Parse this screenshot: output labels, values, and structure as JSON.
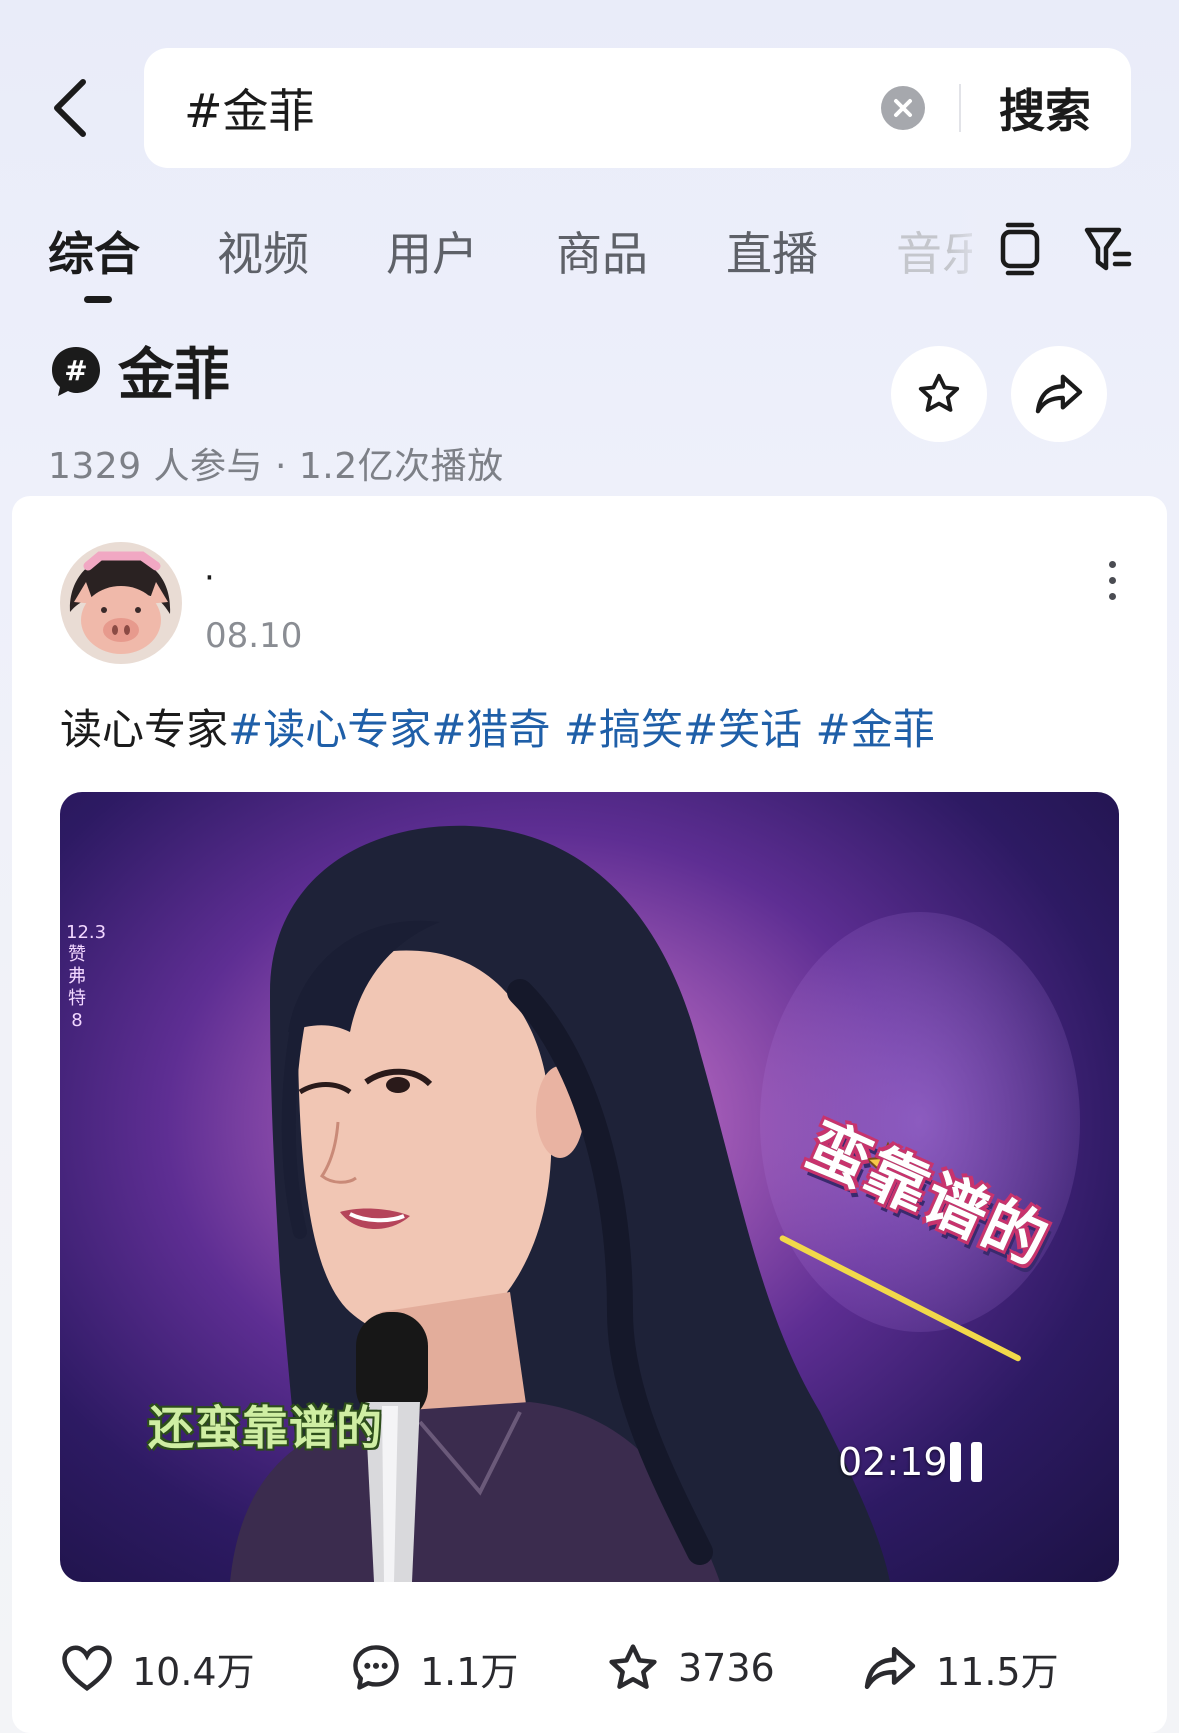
{
  "search": {
    "query": "#金菲",
    "submit_label": "搜索"
  },
  "tabs": [
    {
      "label": "综合"
    },
    {
      "label": "视频"
    },
    {
      "label": "用户"
    },
    {
      "label": "商品"
    },
    {
      "label": "直播"
    },
    {
      "label": "音乐"
    }
  ],
  "topic": {
    "badge": "#",
    "title": "金菲",
    "meta": "1329 人参与 · 1.2亿次播放"
  },
  "post": {
    "author": "·",
    "date": "08.10",
    "caption_text": "读心专家",
    "hashtags": [
      "#读心专家",
      "#猎奇 ",
      "#搞笑",
      "#笑话 ",
      "#金菲"
    ],
    "video": {
      "side_caption": "12.3 赞 弗 特 8",
      "sticker": "蛮靠谱的",
      "subtitle": "还蛮靠谱的",
      "duration": "02:19"
    },
    "stats": {
      "likes": "10.4万",
      "comments": "1.1万",
      "favorites": "3736",
      "shares": "11.5万"
    }
  },
  "colors": {
    "hashtag": "#1f5fa8",
    "background": "#eef0fa",
    "card": "#ffffff"
  },
  "icons": [
    "back-icon",
    "clear-icon",
    "tablet-icon",
    "filter-icon",
    "hashtag-icon",
    "star-icon",
    "share-icon",
    "more-icon",
    "heart-icon",
    "comment-icon",
    "pause-icon"
  ]
}
